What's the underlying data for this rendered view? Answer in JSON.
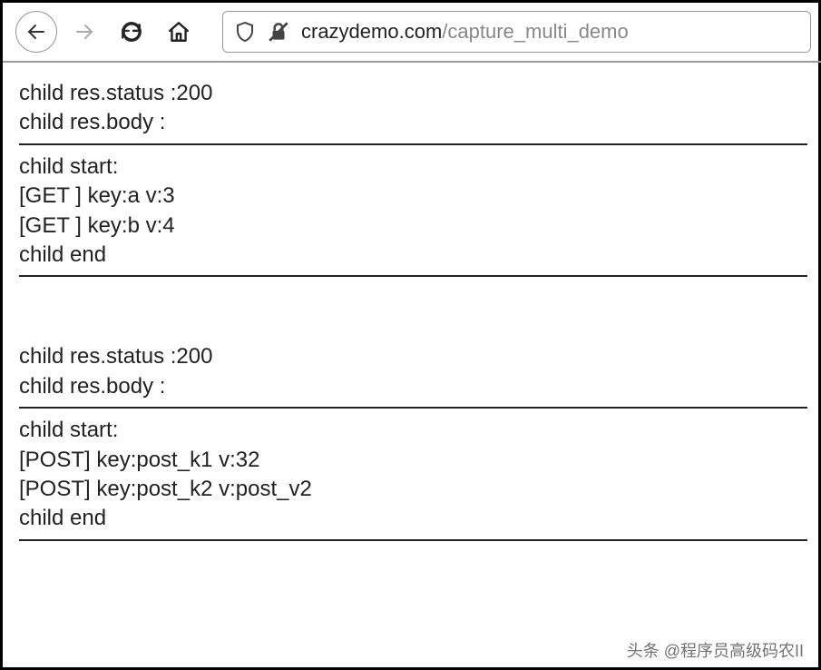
{
  "toolbar": {
    "url_domain": "crazydemo.com",
    "url_path": "/capture_multi_demo"
  },
  "content": {
    "block1": {
      "line1": "child res.status :200",
      "line2": "child res.body :"
    },
    "block2": {
      "line1": "child start:",
      "line2": "[GET ] key:a v:3",
      "line3": "[GET ] key:b v:4",
      "line4": "child end"
    },
    "block3": {
      "line1": "child res.status :200",
      "line2": "child res.body :"
    },
    "block4": {
      "line1": "child start:",
      "line2": "[POST] key:post_k1 v:32",
      "line3": "[POST] key:post_k2 v:post_v2",
      "line4": "child end"
    }
  },
  "watermark": "头条 @程序员高级码农II"
}
